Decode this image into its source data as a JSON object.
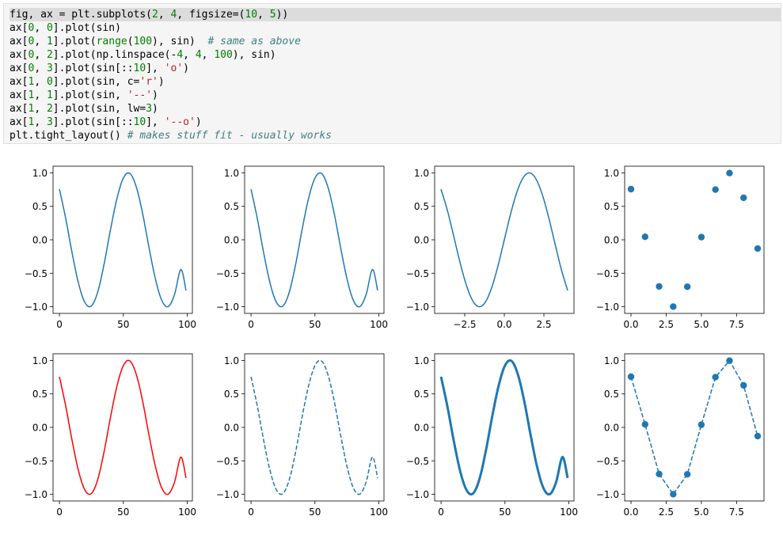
{
  "code": {
    "lines": [
      [
        {
          "t": "fig, ax = plt.subplots("
        },
        {
          "t": "2",
          "c": "num"
        },
        {
          "t": ", "
        },
        {
          "t": "4",
          "c": "num"
        },
        {
          "t": ", figsize=("
        },
        {
          "t": "10",
          "c": "num"
        },
        {
          "t": ", "
        },
        {
          "t": "5",
          "c": "num"
        },
        {
          "t": "))"
        }
      ],
      [
        {
          "t": "ax["
        },
        {
          "t": "0",
          "c": "num"
        },
        {
          "t": ", "
        },
        {
          "t": "0",
          "c": "num"
        },
        {
          "t": "].plot(sin)"
        }
      ],
      [
        {
          "t": "ax["
        },
        {
          "t": "0",
          "c": "num"
        },
        {
          "t": ", "
        },
        {
          "t": "1",
          "c": "num"
        },
        {
          "t": "].plot("
        },
        {
          "t": "range",
          "c": "bi"
        },
        {
          "t": "("
        },
        {
          "t": "100",
          "c": "num"
        },
        {
          "t": "), sin)  "
        },
        {
          "t": "# same as above",
          "c": "com"
        }
      ],
      [
        {
          "t": "ax["
        },
        {
          "t": "0",
          "c": "num"
        },
        {
          "t": ", "
        },
        {
          "t": "2",
          "c": "num"
        },
        {
          "t": "].plot(np.linspace(-"
        },
        {
          "t": "4",
          "c": "num"
        },
        {
          "t": ", "
        },
        {
          "t": "4",
          "c": "num"
        },
        {
          "t": ", "
        },
        {
          "t": "100",
          "c": "num"
        },
        {
          "t": "), sin)"
        }
      ],
      [
        {
          "t": "ax["
        },
        {
          "t": "0",
          "c": "num"
        },
        {
          "t": ", "
        },
        {
          "t": "3",
          "c": "num"
        },
        {
          "t": "].plot(sin[::"
        },
        {
          "t": "10",
          "c": "num"
        },
        {
          "t": "], "
        },
        {
          "t": "'o'",
          "c": "str"
        },
        {
          "t": ")"
        }
      ],
      [
        {
          "t": "ax["
        },
        {
          "t": "1",
          "c": "num"
        },
        {
          "t": ", "
        },
        {
          "t": "0",
          "c": "num"
        },
        {
          "t": "].plot(sin, c="
        },
        {
          "t": "'r'",
          "c": "str"
        },
        {
          "t": ")"
        }
      ],
      [
        {
          "t": "ax["
        },
        {
          "t": "1",
          "c": "num"
        },
        {
          "t": ", "
        },
        {
          "t": "1",
          "c": "num"
        },
        {
          "t": "].plot(sin, "
        },
        {
          "t": "'--'",
          "c": "str"
        },
        {
          "t": ")"
        }
      ],
      [
        {
          "t": "ax["
        },
        {
          "t": "1",
          "c": "num"
        },
        {
          "t": ", "
        },
        {
          "t": "2",
          "c": "num"
        },
        {
          "t": "].plot(sin, lw="
        },
        {
          "t": "3",
          "c": "num"
        },
        {
          "t": ")"
        }
      ],
      [
        {
          "t": "ax["
        },
        {
          "t": "1",
          "c": "num"
        },
        {
          "t": ", "
        },
        {
          "t": "3",
          "c": "num"
        },
        {
          "t": "].plot(sin[::"
        },
        {
          "t": "10",
          "c": "num"
        },
        {
          "t": "], "
        },
        {
          "t": "'--o'",
          "c": "str"
        },
        {
          "t": ")"
        }
      ],
      [
        {
          "t": "plt.tight_layout() "
        },
        {
          "t": "# makes stuff fit - usually works",
          "c": "com"
        }
      ]
    ]
  },
  "colors": {
    "blue": "#1f77b4",
    "red": "#ff0000",
    "code_bg": "#f5f5f5",
    "highlight": "#dcdcdc"
  },
  "chart_data": [
    {
      "type": "line",
      "id": "ax-0-0",
      "x": [
        0,
        5,
        10,
        15,
        20,
        25,
        30,
        35,
        40,
        45,
        50,
        55,
        60,
        65,
        70,
        75,
        80,
        85,
        90,
        95,
        99
      ],
      "y": [
        0.757,
        0.31,
        -0.206,
        -0.656,
        -0.94,
        -0.989,
        -0.776,
        -0.356,
        0.158,
        0.618,
        0.923,
        0.994,
        0.798,
        0.4,
        -0.108,
        -0.578,
        -0.903,
        -0.999,
        -0.82,
        -0.443,
        -0.757
      ],
      "xticks": [
        0,
        50,
        100
      ],
      "xticklabels": [
        "0",
        "50",
        "100"
      ],
      "yticks": [
        1,
        0.5,
        0,
        -0.5,
        -1
      ],
      "yticklabels": [
        "1.0",
        "0.5",
        "0.0",
        "−0.5",
        "−1.0"
      ],
      "xlim": [
        -5,
        104
      ],
      "ylim": [
        -1.1,
        1.1
      ],
      "color": "#1f77b4",
      "linestyle": "solid",
      "linewidth": 1.5,
      "marker": "none"
    },
    {
      "type": "line",
      "id": "ax-0-1",
      "x": [
        0,
        5,
        10,
        15,
        20,
        25,
        30,
        35,
        40,
        45,
        50,
        55,
        60,
        65,
        70,
        75,
        80,
        85,
        90,
        95,
        99
      ],
      "y": [
        0.757,
        0.31,
        -0.206,
        -0.656,
        -0.94,
        -0.989,
        -0.776,
        -0.356,
        0.158,
        0.618,
        0.923,
        0.994,
        0.798,
        0.4,
        -0.108,
        -0.578,
        -0.903,
        -0.999,
        -0.82,
        -0.443,
        -0.757
      ],
      "xticks": [
        0,
        50,
        100
      ],
      "xticklabels": [
        "0",
        "50",
        "100"
      ],
      "yticks": [
        1,
        0.5,
        0,
        -0.5,
        -1
      ],
      "yticklabels": [
        "1.0",
        "0.5",
        "0.0",
        "−0.5",
        "−1.0"
      ],
      "xlim": [
        -5,
        104
      ],
      "ylim": [
        -1.1,
        1.1
      ],
      "color": "#1f77b4",
      "linestyle": "solid",
      "linewidth": 1.5,
      "marker": "none"
    },
    {
      "type": "line",
      "id": "ax-0-2",
      "x": [
        -4,
        -3.6,
        -3.2,
        -2.8,
        -2.4,
        -2.0,
        -1.6,
        -1.2,
        -0.8,
        -0.4,
        0,
        0.4,
        0.8,
        1.2,
        1.6,
        2.0,
        2.4,
        2.8,
        3.2,
        3.6,
        4
      ],
      "y": [
        0.757,
        0.443,
        0.058,
        -0.335,
        -0.675,
        -0.909,
        -1.0,
        -0.932,
        -0.717,
        -0.389,
        0,
        0.389,
        0.717,
        0.932,
        1.0,
        0.909,
        0.675,
        0.335,
        -0.058,
        -0.443,
        -0.757
      ],
      "xticks": [
        -2.5,
        0,
        2.5
      ],
      "xticklabels": [
        "−2.5",
        "0.0",
        "2.5"
      ],
      "yticks": [
        1,
        0.5,
        0,
        -0.5,
        -1
      ],
      "yticklabels": [
        "1.0",
        "0.5",
        "0.0",
        "−0.5",
        "−1.0"
      ],
      "xlim": [
        -4.4,
        4.4
      ],
      "ylim": [
        -1.1,
        1.1
      ],
      "color": "#1f77b4",
      "linestyle": "solid",
      "linewidth": 1.5,
      "marker": "none"
    },
    {
      "type": "scatter",
      "id": "ax-0-3",
      "x": [
        0,
        1,
        2,
        3,
        4,
        5,
        6,
        7,
        8,
        9
      ],
      "y": [
        0.757,
        0.045,
        -0.697,
        -0.999,
        -0.701,
        0.04,
        0.75,
        0.997,
        0.628,
        -0.131
      ],
      "xticks": [
        0,
        2.5,
        5,
        7.5
      ],
      "xticklabels": [
        "0.0",
        "2.5",
        "5.0",
        "7.5"
      ],
      "yticks": [
        1,
        0.5,
        0,
        -0.5,
        -1
      ],
      "yticklabels": [
        "1.0",
        "0.5",
        "0.0",
        "−0.5",
        "−1.0"
      ],
      "xlim": [
        -0.45,
        9.45
      ],
      "ylim": [
        -1.1,
        1.1
      ],
      "color": "#1f77b4",
      "linestyle": "none",
      "linewidth": 1.5,
      "marker": "o"
    },
    {
      "type": "line",
      "id": "ax-1-0",
      "x": [
        0,
        5,
        10,
        15,
        20,
        25,
        30,
        35,
        40,
        45,
        50,
        55,
        60,
        65,
        70,
        75,
        80,
        85,
        90,
        95,
        99
      ],
      "y": [
        0.757,
        0.31,
        -0.206,
        -0.656,
        -0.94,
        -0.989,
        -0.776,
        -0.356,
        0.158,
        0.618,
        0.923,
        0.994,
        0.798,
        0.4,
        -0.108,
        -0.578,
        -0.903,
        -0.999,
        -0.82,
        -0.443,
        -0.757
      ],
      "xticks": [
        0,
        50,
        100
      ],
      "xticklabels": [
        "0",
        "50",
        "100"
      ],
      "yticks": [
        1,
        0.5,
        0,
        -0.5,
        -1
      ],
      "yticklabels": [
        "1.0",
        "0.5",
        "0.0",
        "−0.5",
        "−1.0"
      ],
      "xlim": [
        -5,
        104
      ],
      "ylim": [
        -1.1,
        1.1
      ],
      "color": "#ff0000",
      "linestyle": "solid",
      "linewidth": 1.5,
      "marker": "none"
    },
    {
      "type": "line",
      "id": "ax-1-1",
      "x": [
        0,
        5,
        10,
        15,
        20,
        25,
        30,
        35,
        40,
        45,
        50,
        55,
        60,
        65,
        70,
        75,
        80,
        85,
        90,
        95,
        99
      ],
      "y": [
        0.757,
        0.31,
        -0.206,
        -0.656,
        -0.94,
        -0.989,
        -0.776,
        -0.356,
        0.158,
        0.618,
        0.923,
        0.994,
        0.798,
        0.4,
        -0.108,
        -0.578,
        -0.903,
        -0.999,
        -0.82,
        -0.443,
        -0.757
      ],
      "xticks": [
        0,
        50,
        100
      ],
      "xticklabels": [
        "0",
        "50",
        "100"
      ],
      "yticks": [
        1,
        0.5,
        0,
        -0.5,
        -1
      ],
      "yticklabels": [
        "1.0",
        "0.5",
        "0.0",
        "−0.5",
        "−1.0"
      ],
      "xlim": [
        -5,
        104
      ],
      "ylim": [
        -1.1,
        1.1
      ],
      "color": "#1f77b4",
      "linestyle": "dashed",
      "linewidth": 1.5,
      "marker": "none"
    },
    {
      "type": "line",
      "id": "ax-1-2",
      "x": [
        0,
        5,
        10,
        15,
        20,
        25,
        30,
        35,
        40,
        45,
        50,
        55,
        60,
        65,
        70,
        75,
        80,
        85,
        90,
        95,
        99
      ],
      "y": [
        0.757,
        0.31,
        -0.206,
        -0.656,
        -0.94,
        -0.989,
        -0.776,
        -0.356,
        0.158,
        0.618,
        0.923,
        0.994,
        0.798,
        0.4,
        -0.108,
        -0.578,
        -0.903,
        -0.999,
        -0.82,
        -0.443,
        -0.757
      ],
      "xticks": [
        0,
        50,
        100
      ],
      "xticklabels": [
        "0",
        "50",
        "100"
      ],
      "yticks": [
        1,
        0.5,
        0,
        -0.5,
        -1
      ],
      "yticklabels": [
        "1.0",
        "0.5",
        "0.0",
        "−0.5",
        "−1.0"
      ],
      "xlim": [
        -5,
        104
      ],
      "ylim": [
        -1.1,
        1.1
      ],
      "color": "#1f77b4",
      "linestyle": "solid",
      "linewidth": 3,
      "marker": "none"
    },
    {
      "type": "line",
      "id": "ax-1-3",
      "x": [
        0,
        1,
        2,
        3,
        4,
        5,
        6,
        7,
        8,
        9
      ],
      "y": [
        0.757,
        0.045,
        -0.697,
        -0.999,
        -0.701,
        0.04,
        0.75,
        0.997,
        0.628,
        -0.131
      ],
      "xticks": [
        0,
        2.5,
        5,
        7.5
      ],
      "xticklabels": [
        "0.0",
        "2.5",
        "5.0",
        "7.5"
      ],
      "yticks": [
        1,
        0.5,
        0,
        -0.5,
        -1
      ],
      "yticklabels": [
        "1.0",
        "0.5",
        "0.0",
        "−0.5",
        "−1.0"
      ],
      "xlim": [
        -0.45,
        9.45
      ],
      "ylim": [
        -1.1,
        1.1
      ],
      "color": "#1f77b4",
      "linestyle": "dashed",
      "linewidth": 1.5,
      "marker": "o"
    }
  ]
}
